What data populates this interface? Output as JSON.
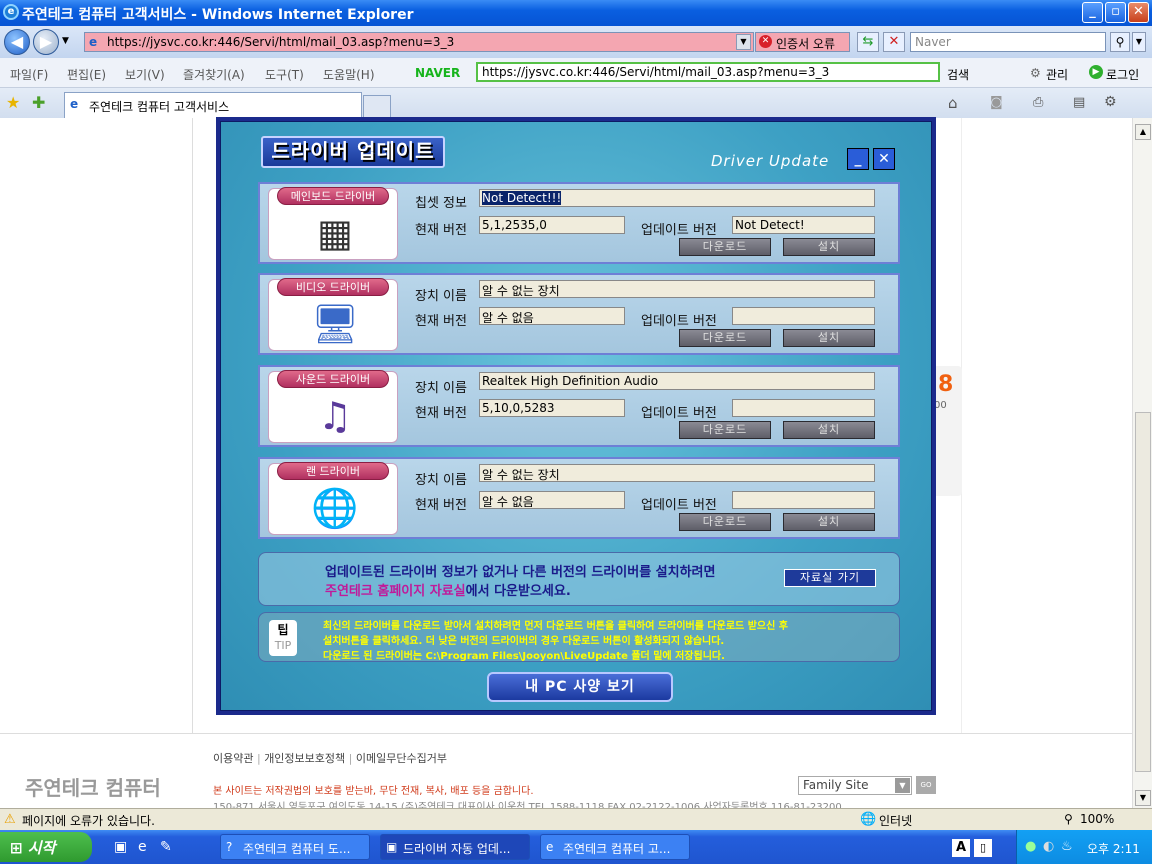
{
  "window": {
    "title": "주연테크 컴퓨터 고객서비스 - Windows Internet Explorer"
  },
  "toolbar": {
    "url": "https://jysvc.co.kr:446/Servi/html/mail_03.asp?menu=3_3",
    "cert_error": "인증서 오류",
    "search_placeholder": "Naver"
  },
  "menu": {
    "items": [
      "파일(F)",
      "편집(E)",
      "보기(V)",
      "즐겨찾기(A)",
      "도구(T)",
      "도움말(H)"
    ],
    "naver_label": "NAVER",
    "naver_url": "https://jysvc.co.kr:446/Servi/html/mail_03.asp?menu=3_3",
    "search": "검색",
    "manage": "관리",
    "login": "로그인"
  },
  "tab": {
    "title": "주연테크 컴퓨터 고객서비스"
  },
  "dialog": {
    "title": "드라이버 업데이트",
    "subtitle": "Driver Update",
    "download_label": "다운로드",
    "install_label": "설치",
    "current_version_label": "현재 버전",
    "update_version_label": "업데이트 버전",
    "sections": [
      {
        "name": "메인보드 드라이버",
        "field1_label": "칩셋 정보",
        "field1_value": "Not Detect!!!",
        "current": "5,1,2535,0",
        "update": "Not Detect!"
      },
      {
        "name": "비디오 드라이버",
        "field1_label": "장치 이름",
        "field1_value": "알 수 없는 장치",
        "current": "알 수 없음",
        "update": ""
      },
      {
        "name": "사운드 드라이버",
        "field1_label": "장치 이름",
        "field1_value": "Realtek High Definition Audio",
        "current": "5,10,0,5283",
        "update": ""
      },
      {
        "name": "랜 드라이버",
        "field1_label": "장치 이름",
        "field1_value": "알 수 없는 장치",
        "current": "알 수 없음",
        "update": ""
      }
    ],
    "info_line1": "업데이트된 드라이버 정보가 없거나 다른 버전의 드라이버를 설치하려면",
    "info_line2_highlight": "주연테크 홈페이지 자료실",
    "info_line2_rest": "에서 다운받으세요.",
    "library_button": "자료실 가기",
    "tip_label": "팁",
    "tip_label2": "TIP",
    "tip_lines": [
      "최신의 드라이버를 다운로드 받아서 설치하려면 먼저 다운로드 버튼을 클릭하여 드라이버를 다운로드 받으신 후",
      "설치버튼을 클릭하세요. 더 낮은 버전의 드라이버의 경우 다운로드 버튼이 활성화되지 않습니다.",
      "다운로드 된 드라이버는 C:\\Program Files\\Jooyon\\LiveUpdate 폴더 밑에 저장됩니다."
    ],
    "pc_spec_button": "내 PC 사양 보기"
  },
  "side_widget": {
    "number": "8",
    "sub": "00"
  },
  "footer": {
    "logo": "주연테크 컴퓨터",
    "links": [
      "이용약관",
      "개인정보보호정책",
      "이메일무단수집거부"
    ],
    "copyright": "본 사이트는 저작권법의 보호를 받는바, 무단 전재, 복사, 배포 등을 금합니다.",
    "address": "150-871 서울시 영등포구 여의도동 14-15 (주)주연테크  대표이사 이운천  TEL 1588-1118  FAX 02-2122-1006  사업자등록번호 116-81-23200",
    "family_site": "Family Site",
    "go": "GO"
  },
  "statusbar": {
    "error": "페이지에 오류가 있습니다.",
    "zone": "인터넷",
    "zoom": "100%"
  },
  "taskbar": {
    "start": "시작",
    "tasks": [
      "주연테크 컴퓨터 도...",
      "드라이버 자동 업데...",
      "주연테크 컴퓨터 고..."
    ],
    "clock": "오후 2:11"
  }
}
